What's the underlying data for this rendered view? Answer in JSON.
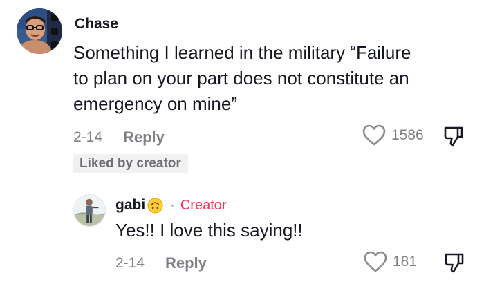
{
  "comment": {
    "username": "Chase",
    "text_lines": [
      "Something I learned in the military “Failure",
      "to plan on your part does not constitute an",
      "emergency on mine”"
    ],
    "date": "2-14",
    "reply_label": "Reply",
    "like_count": "1586",
    "liked_by_creator": "Liked by creator"
  },
  "reply": {
    "username": "gabi",
    "emoji": "upside-down-face-emoji",
    "separator": "·",
    "creator_label": "Creator",
    "text": "Yes!! I love this saying!!",
    "date": "2-14",
    "reply_label": "Reply",
    "like_count": "181"
  },
  "colors": {
    "text": "#161823",
    "muted": "#8a8b91",
    "creator": "#fe2c55",
    "badge_bg": "#f1f1f2"
  },
  "icons": {
    "like": "heart-outline-icon",
    "dislike": "thumbs-down-outline-icon"
  }
}
